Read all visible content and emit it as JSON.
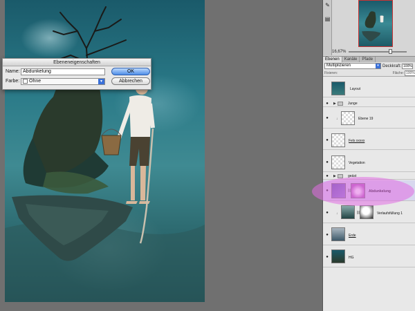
{
  "dialog": {
    "title": "Ebeneneigenschaften",
    "name_label": "Name:",
    "name_value": "Abdunkelung",
    "farbe_label": "Farbe:",
    "farbe_value": "Ohne",
    "ok_label": "OK",
    "cancel_label": "Abbrechen"
  },
  "navigator": {
    "zoom": "16,67%"
  },
  "layers_panel": {
    "tabs": [
      "Ebenen",
      "Kanäle",
      "Pfade"
    ],
    "blend_mode": "Multiplizieren",
    "opacity_label": "Deckkraft:",
    "opacity_value": "100%",
    "lock_label": "Fixieren:",
    "fill_label": "Fläche:",
    "fill_value": "100%",
    "layers": [
      {
        "name": "Layout"
      },
      {
        "name": "Junge"
      },
      {
        "name": "Ebene 19"
      },
      {
        "name": "Fels xxxxx"
      },
      {
        "name": "Vegetation"
      },
      {
        "name": "geäst"
      },
      {
        "name": "Abdunkelung"
      },
      {
        "name": "Verlaufsfüllung 1"
      },
      {
        "name": "Erde"
      },
      {
        "name": "HG"
      }
    ]
  },
  "colors": {
    "highlight": "#e26ee4",
    "ok_button": "#4e8ee8",
    "canvas_teal": "#2a7a88"
  }
}
